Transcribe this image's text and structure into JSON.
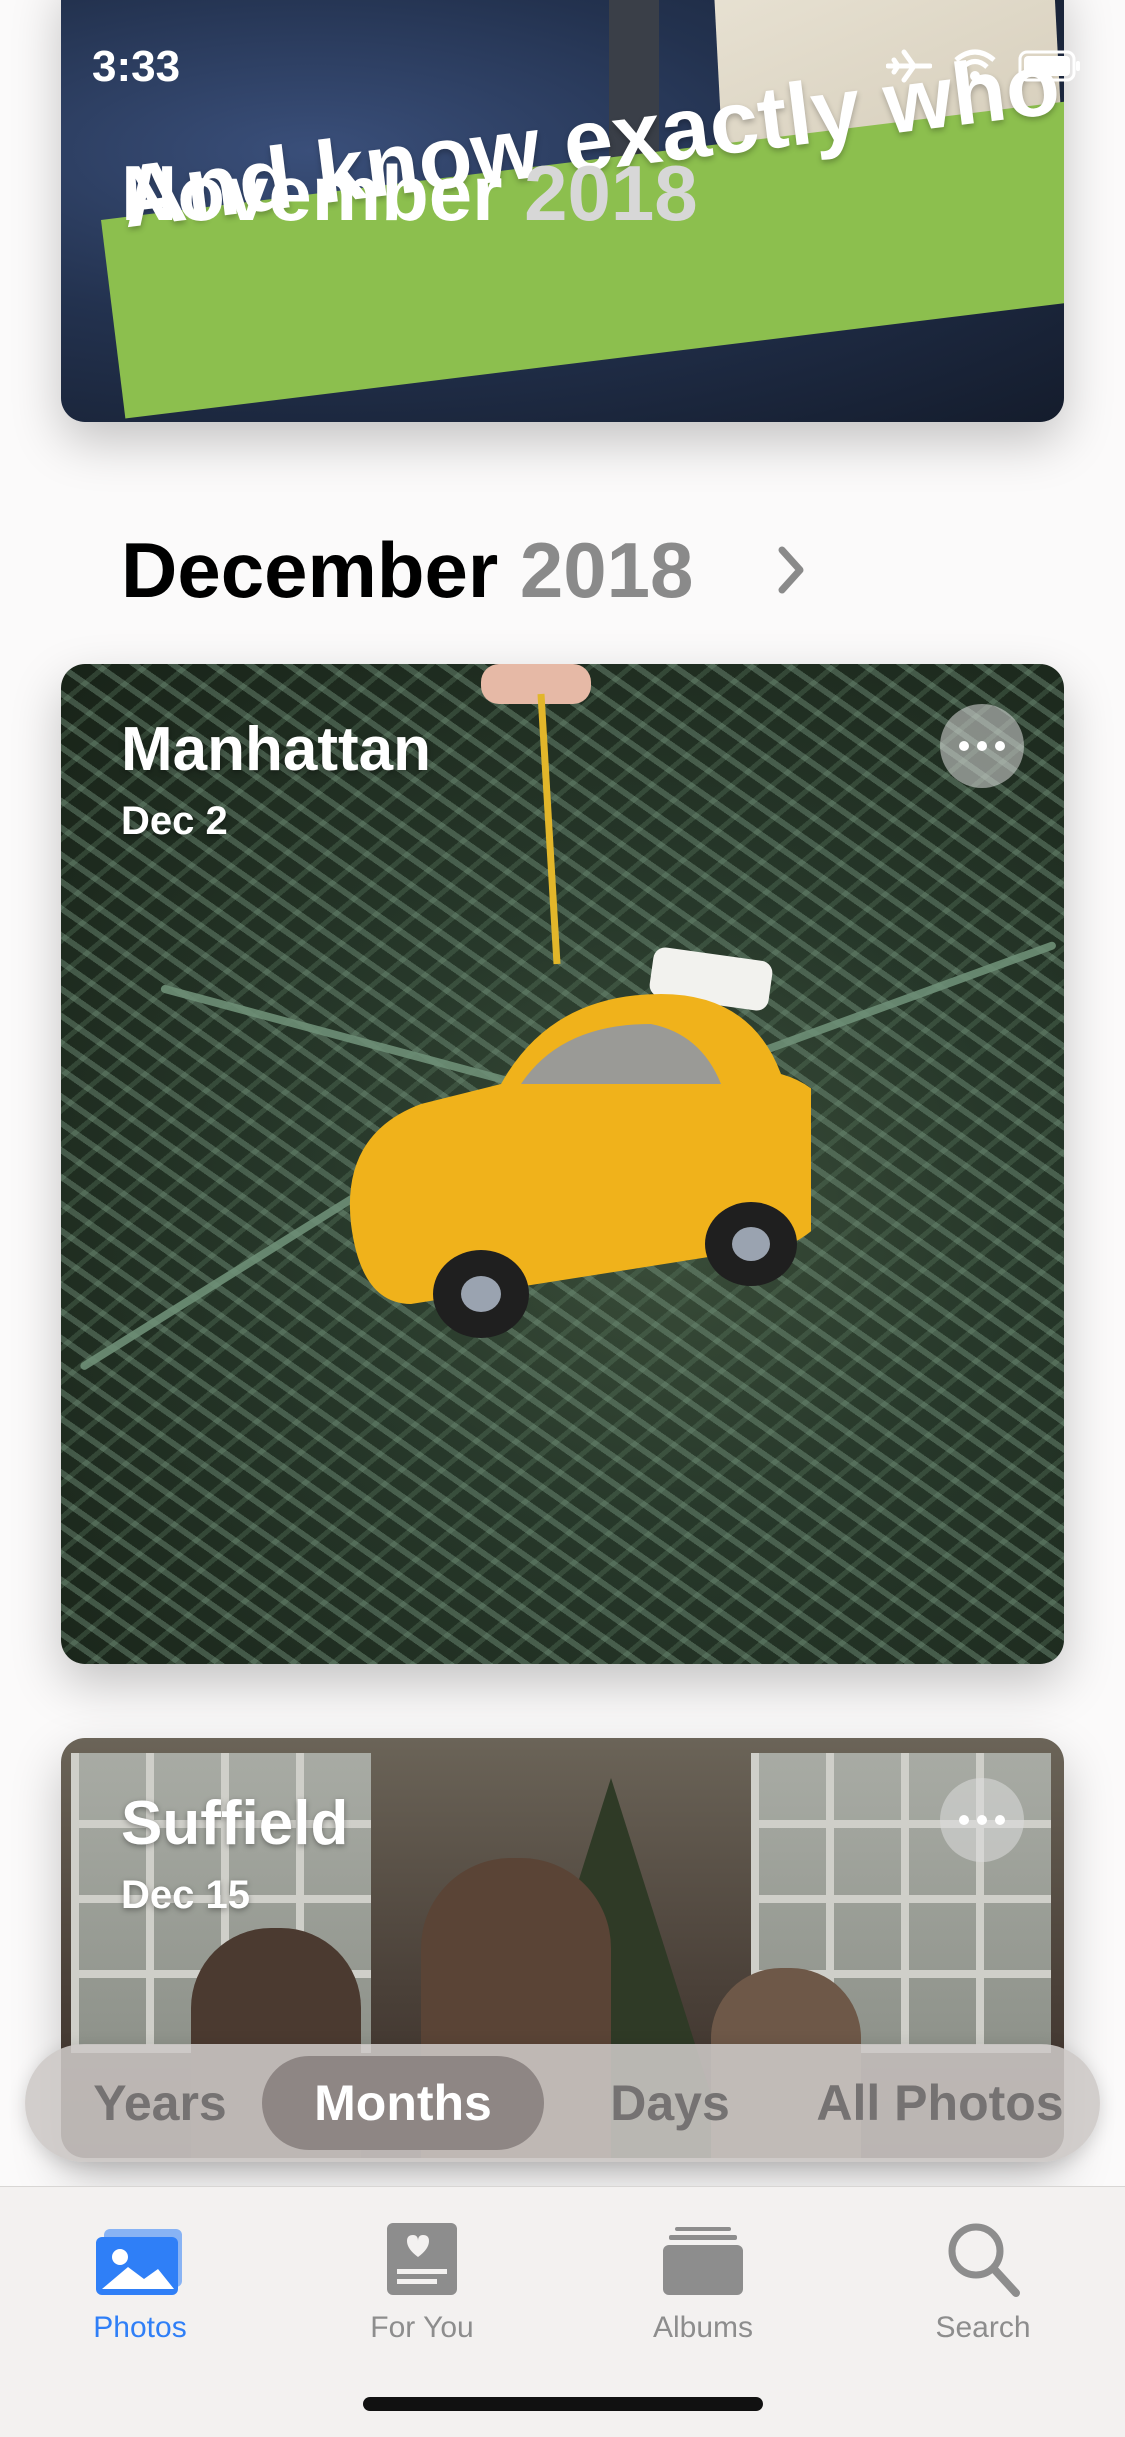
{
  "status_bar": {
    "time": "3:33"
  },
  "sections": {
    "november": {
      "month": "November",
      "year": "2018",
      "overlay_text": "And know exactly who"
    },
    "december": {
      "month": "December",
      "year": "2018",
      "cards": [
        {
          "title": "Manhattan",
          "date": "Dec 2"
        },
        {
          "title": "Suffield",
          "date": "Dec 15"
        }
      ]
    }
  },
  "segment_control": {
    "options": [
      "Years",
      "Months",
      "Days",
      "All Photos"
    ],
    "selected": "Months"
  },
  "tab_bar": {
    "items": [
      {
        "label": "Photos",
        "icon": "photos-icon"
      },
      {
        "label": "For You",
        "icon": "for-you-icon"
      },
      {
        "label": "Albums",
        "icon": "albums-icon"
      },
      {
        "label": "Search",
        "icon": "search-icon"
      }
    ],
    "active": "Photos"
  },
  "colors": {
    "accent": "#2f7ff7",
    "banner_green": "#8cbf4e"
  }
}
